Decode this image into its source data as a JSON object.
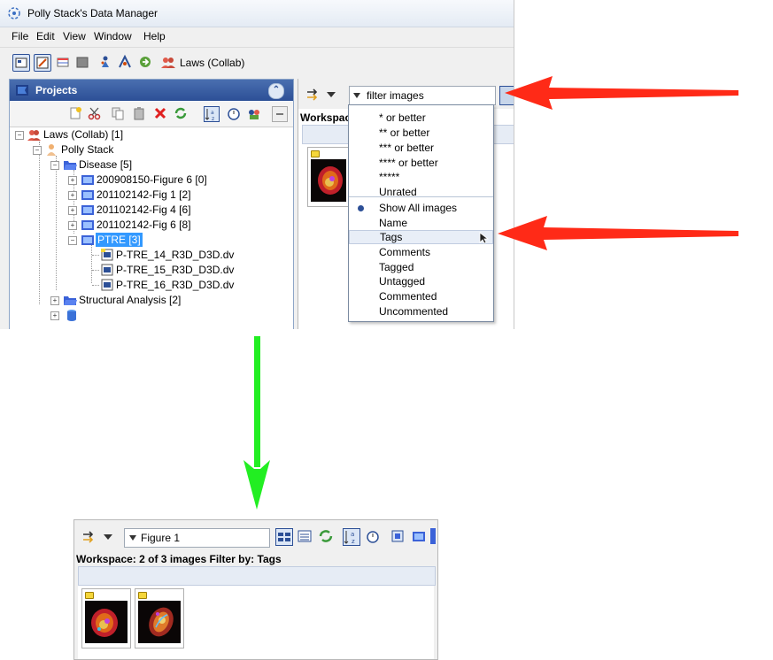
{
  "window": {
    "title": "Polly Stack's Data Manager",
    "menu": [
      "File",
      "Edit",
      "View",
      "Window",
      "Help"
    ],
    "toolbar_project": "Laws (Collab)"
  },
  "projects": {
    "panel_title": "Projects",
    "tree": {
      "root": "Laws (Collab) [1]",
      "user": "Polly Stack",
      "disease": "Disease [5]",
      "datasets": [
        "200908150-Figure 6 [0]",
        "201102142-Fig 1  [2]",
        "201102142-Fig 4 [6]",
        "201102142-Fig 6 [8]"
      ],
      "selected": "PTRE [3]",
      "files": [
        "P-TRE_14_R3D_D3D.dv",
        "P-TRE_15_R3D_D3D.dv",
        "P-TRE_16_R3D_D3D.dv"
      ],
      "structural": "Structural Analysis [2]"
    }
  },
  "filter_panel": {
    "filter_text": "filter  images",
    "workspace_label": "Workspac",
    "dropdown": {
      "ratings": [
        "* or better",
        "** or better",
        "*** or better",
        "**** or better",
        "*****",
        "Unrated"
      ],
      "options": [
        "Show All  images",
        "Name",
        "Tags",
        "Comments",
        "Tagged",
        "Untagged",
        "Commented",
        "Uncommented"
      ],
      "selected": "Show All  images",
      "highlighted": "Tags"
    }
  },
  "result_panel": {
    "filter_text": "Figure 1",
    "status": "Workspace: 2 of 3 images   Filter by: Tags"
  },
  "colors": {
    "arrow_red": "#ff2a17",
    "arrow_green": "#22ee22",
    "selection": "#3399ff",
    "header_blue": "#2c4f96"
  }
}
